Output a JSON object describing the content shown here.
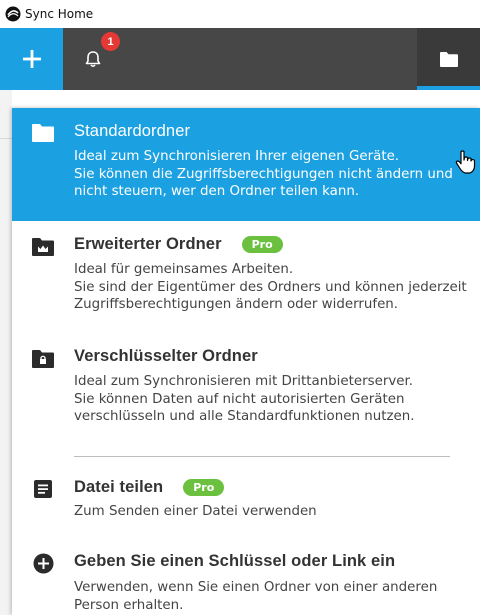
{
  "window": {
    "title": "Sync Home"
  },
  "toolbar": {
    "add_icon": "plus-icon",
    "notification_icon": "bell-icon",
    "notification_count": "1",
    "folder_icon": "folder-icon",
    "accent": "#1ba1e2",
    "bg": "#474747"
  },
  "menu": {
    "items": [
      {
        "icon": "folder-icon",
        "title": "Standardordner",
        "desc": [
          "Ideal zum Synchronisieren Ihrer eigenen Geräte.",
          "Sie können die Zugriffsberechtigungen nicht ändern und",
          "nicht steuern, wer den Ordner teilen kann."
        ],
        "selected": true
      },
      {
        "icon": "team-folder-icon",
        "title": "Erweiterter Ordner",
        "badge": "Pro",
        "desc": [
          "Ideal für gemeinsames Arbeiten.",
          "Sie sind der Eigentümer des Ordners und können jederzeit",
          "Zugriffsberechtigungen ändern oder widerrufen."
        ]
      },
      {
        "icon": "lock-folder-icon",
        "title": "Verschlüsselter Ordner",
        "desc": [
          "Ideal zum Synchronisieren mit Drittanbieterserver.",
          "Sie können Daten auf nicht autorisierten Geräten",
          "verschlüsseln und alle Standardfunktionen nutzen."
        ]
      },
      {
        "icon": "document-icon",
        "title": "Datei teilen",
        "badge": "Pro",
        "desc": [
          "Zum Senden einer Datei verwenden"
        ]
      },
      {
        "icon": "plus-circle-icon",
        "title": "Geben Sie einen Schlüssel oder Link ein",
        "desc": [
          "Verwenden, wenn Sie einen Ordner von einer anderen",
          "Person erhalten."
        ]
      }
    ]
  },
  "pro_color": "#6bc13f"
}
